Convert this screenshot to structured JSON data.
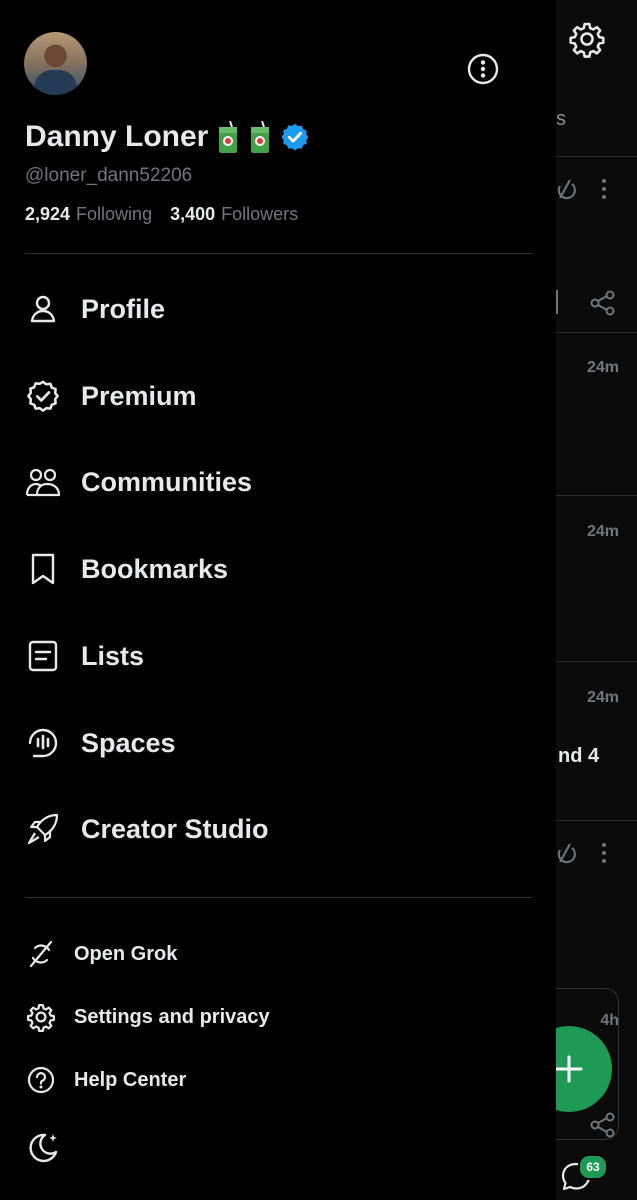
{
  "profile": {
    "name": "Danny Loner",
    "handle": "@loner_dann52206",
    "following_count": "2,924",
    "following_label": "Following",
    "followers_count": "3,400",
    "followers_label": "Followers",
    "verified": true,
    "verified_color": "#1d9bf0"
  },
  "menu": {
    "items": [
      {
        "label": "Profile",
        "icon": "person-icon"
      },
      {
        "label": "Premium",
        "icon": "premium-badge-icon"
      },
      {
        "label": "Communities",
        "icon": "communities-icon"
      },
      {
        "label": "Bookmarks",
        "icon": "bookmark-icon"
      },
      {
        "label": "Lists",
        "icon": "list-icon"
      },
      {
        "label": "Spaces",
        "icon": "spaces-icon"
      },
      {
        "label": "Creator Studio",
        "icon": "rocket-icon"
      }
    ],
    "secondary": [
      {
        "label": "Open Grok",
        "icon": "grok-icon"
      },
      {
        "label": "Settings and privacy",
        "icon": "gear-icon"
      },
      {
        "label": "Help Center",
        "icon": "help-icon"
      }
    ]
  },
  "feed": {
    "tab_fragment": "s",
    "times": [
      "24m",
      "24m",
      "24m",
      "4h"
    ],
    "text_fragment": "nd 4",
    "messages_badge": "63"
  },
  "colors": {
    "background": "#000000",
    "accent_green": "#1d9b55",
    "muted_text": "#71767b"
  }
}
